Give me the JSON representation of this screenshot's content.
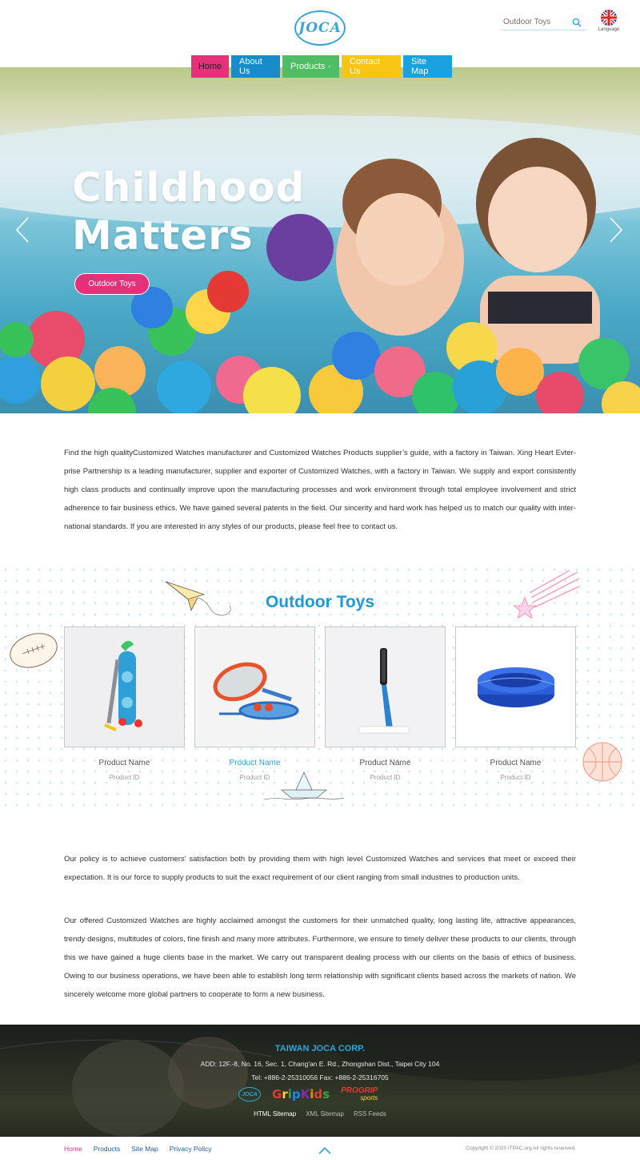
{
  "header": {
    "logo_text": "JOCA",
    "search_placeholder": "Outdoor Toys",
    "language_label": "Language"
  },
  "nav": {
    "home": "Home",
    "about": "About Us",
    "products": "Products",
    "contact": "Contact Us",
    "sitemap": "Site Map"
  },
  "hero": {
    "title_line1": "Childhood",
    "title_line2": "Matters",
    "button": "Outdoor Toys"
  },
  "intro": {
    "text": "Find the high qualityCustomized Watches manufacturer and Customized Watches Products supplier’s guide, with a factory in Taiwan. Xing Heart Evter-prise Partnership is a leading manufacturer, supplier and exporter of Customized Watches, with a factory in Taiwan. We supply and export consistently high class products and continually improve upon the manufacturing processes and work environment through total employee involvement and strict adherence to fair business ethics. We have gained several patents in the field. Our sincerity and hard work has helped us to match our quality with inter-national standards. If you are interested in any styles of our products, please feel free to contact us."
  },
  "toys": {
    "title": "Outdoor Toys",
    "products": [
      {
        "name": "Product Name",
        "id": "Product ID"
      },
      {
        "name": "Product Name",
        "id": "Product ID"
      },
      {
        "name": "Product Name",
        "id": "Product ID"
      },
      {
        "name": "Product Name",
        "id": "Product ID"
      }
    ]
  },
  "policy": {
    "text1": "Our policy is to achieve customers' satisfaction both by providing them with high level Customized Watches and services that meet or exceed their expectation. It is our force to supply products to suit the exact requirement of our client ranging from small industries to production units.",
    "text2": "Our offered Customized Watches are highly acclaimed amongst the customers for their unmatched quality, long lasting life, attractive appearances, trendy designs, multitudes of colors, fine finish and many more attributes. Furthermore, we ensure to timely deliver these products to our clients, through this we have gained a huge clients base in the market. We carry out transparent dealing process with our clients on the basis of ethics of business. Owing to our business operations, we have been able to establish long term relationship with significant clients based across the markets of nation. We sincerely welcome more global partners to cooperate to form a new business."
  },
  "footer": {
    "company": "TAIWAN JOCA CORP.",
    "address": "ADD: 12F.-8, No. 16, Sec. 1, Chang'an E. Rd., Zhongshan Dist., Taipei City 104",
    "contact": "Tel: +886-2-25310056    Fax: +886-2-25316705",
    "logo_joca": "JOCA",
    "logo_gripkids": [
      "G",
      "r",
      "i",
      "p",
      "K",
      "i",
      "d",
      "s"
    ],
    "logo_progrip": "PROGRIP",
    "logo_sports": "sports",
    "links": [
      "HTML Sitemap",
      "XML Sitemap",
      "RSS Feeds"
    ]
  },
  "bottom": {
    "links": [
      "Home",
      "Products",
      "Site Map",
      "Privacy Policy"
    ],
    "copyright": "Copyright © 2020 ITPAC.org All rights reserved."
  },
  "colors": {
    "pink": "#e5317a",
    "blue": "#168dca",
    "green": "#4fbd63",
    "yellow": "#f9c514",
    "sky": "#1aa1df",
    "title_blue": "#1c9ad6"
  }
}
